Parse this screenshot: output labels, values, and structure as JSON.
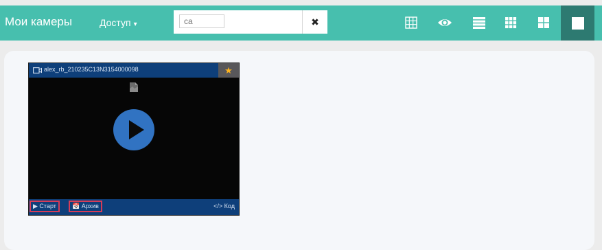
{
  "header": {
    "title": "Мои камеры",
    "access_label": "Доступ",
    "access_caret": "▾",
    "search": {
      "value": "ca",
      "clear_glyph": "✖"
    },
    "view_modes": [
      {
        "name": "grid-small-icon"
      },
      {
        "name": "eye-icon"
      },
      {
        "name": "list-icon"
      },
      {
        "name": "grid-columns-icon"
      },
      {
        "name": "grid-large-icon"
      },
      {
        "name": "single-view-icon",
        "active": true
      }
    ],
    "colors": {
      "bar": "#47bfae",
      "active": "#2d7a71"
    }
  },
  "camera": {
    "name": "alex_rb_210235C13N3154000098",
    "favorite_glyph": "★",
    "start_label": "▶ Старт",
    "archive_label": "📅 Архив",
    "code_label": "</> Код",
    "colors": {
      "header": "#0e3f7a",
      "play": "#3173c2",
      "favorite": "#ffb41e",
      "highlight": "#d63c58"
    }
  }
}
